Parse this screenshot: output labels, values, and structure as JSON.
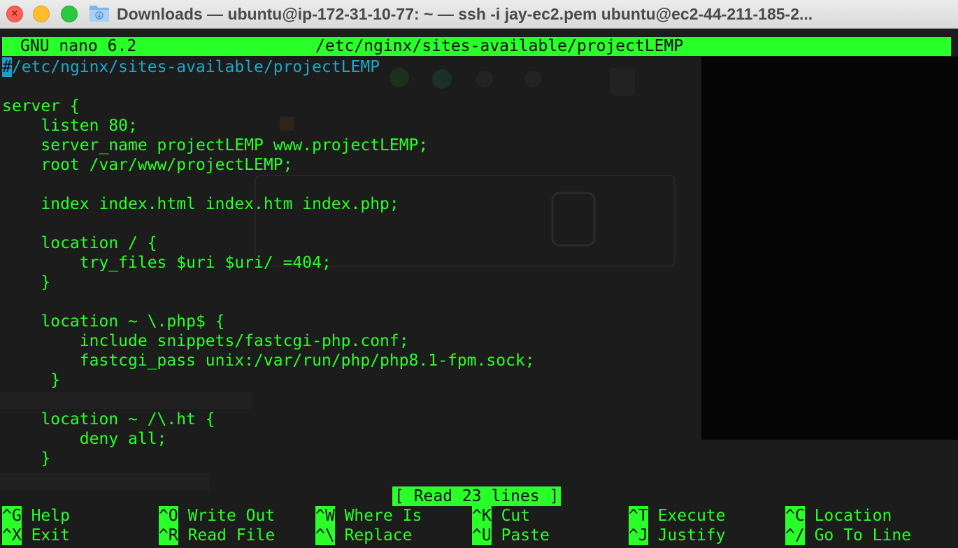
{
  "window": {
    "title": "Downloads — ubuntu@ip-172-31-10-77: ~ — ssh -i jay-ec2.pem ubuntu@ec2-44-211-185-2..."
  },
  "nano": {
    "version": "GNU nano 6.2",
    "file_path": "/etc/nginx/sites-available/projectLEMP",
    "cursor_char": "#",
    "first_line_rest": "/etc/nginx/sites-available/projectLEMP",
    "lines": [
      "",
      "server {",
      "    listen 80;",
      "    server_name projectLEMP www.projectLEMP;",
      "    root /var/www/projectLEMP;",
      "",
      "    index index.html index.htm index.php;",
      "",
      "    location / {",
      "        try_files $uri $uri/ =404;",
      "    }",
      "",
      "    location ~ \\.php$ {",
      "        include snippets/fastcgi-php.conf;",
      "        fastcgi_pass unix:/var/run/php/php8.1-fpm.sock;",
      "     }",
      "",
      "    location ~ /\\.ht {",
      "        deny all;",
      "    }"
    ],
    "status_message": "[ Read 23 lines ]",
    "shortcuts": [
      {
        "key": "^G",
        "label": "Help"
      },
      {
        "key": "^O",
        "label": "Write Out"
      },
      {
        "key": "^W",
        "label": "Where Is"
      },
      {
        "key": "^K",
        "label": "Cut"
      },
      {
        "key": "^T",
        "label": "Execute"
      },
      {
        "key": "^C",
        "label": "Location"
      },
      {
        "key": "^X",
        "label": "Exit"
      },
      {
        "key": "^R",
        "label": "Read File"
      },
      {
        "key": "^\\",
        "label": "Replace"
      },
      {
        "key": "^U",
        "label": "Paste"
      },
      {
        "key": "^J",
        "label": "Justify"
      },
      {
        "key": "^/",
        "label": "Go To Line"
      }
    ]
  },
  "colors": {
    "terminal_fg": "#29ff29",
    "terminal_bg": "#1c1c1c",
    "cursor": "#1f9bd2",
    "path_text": "#1fa8c8"
  },
  "icons": [
    "folder-icon"
  ]
}
